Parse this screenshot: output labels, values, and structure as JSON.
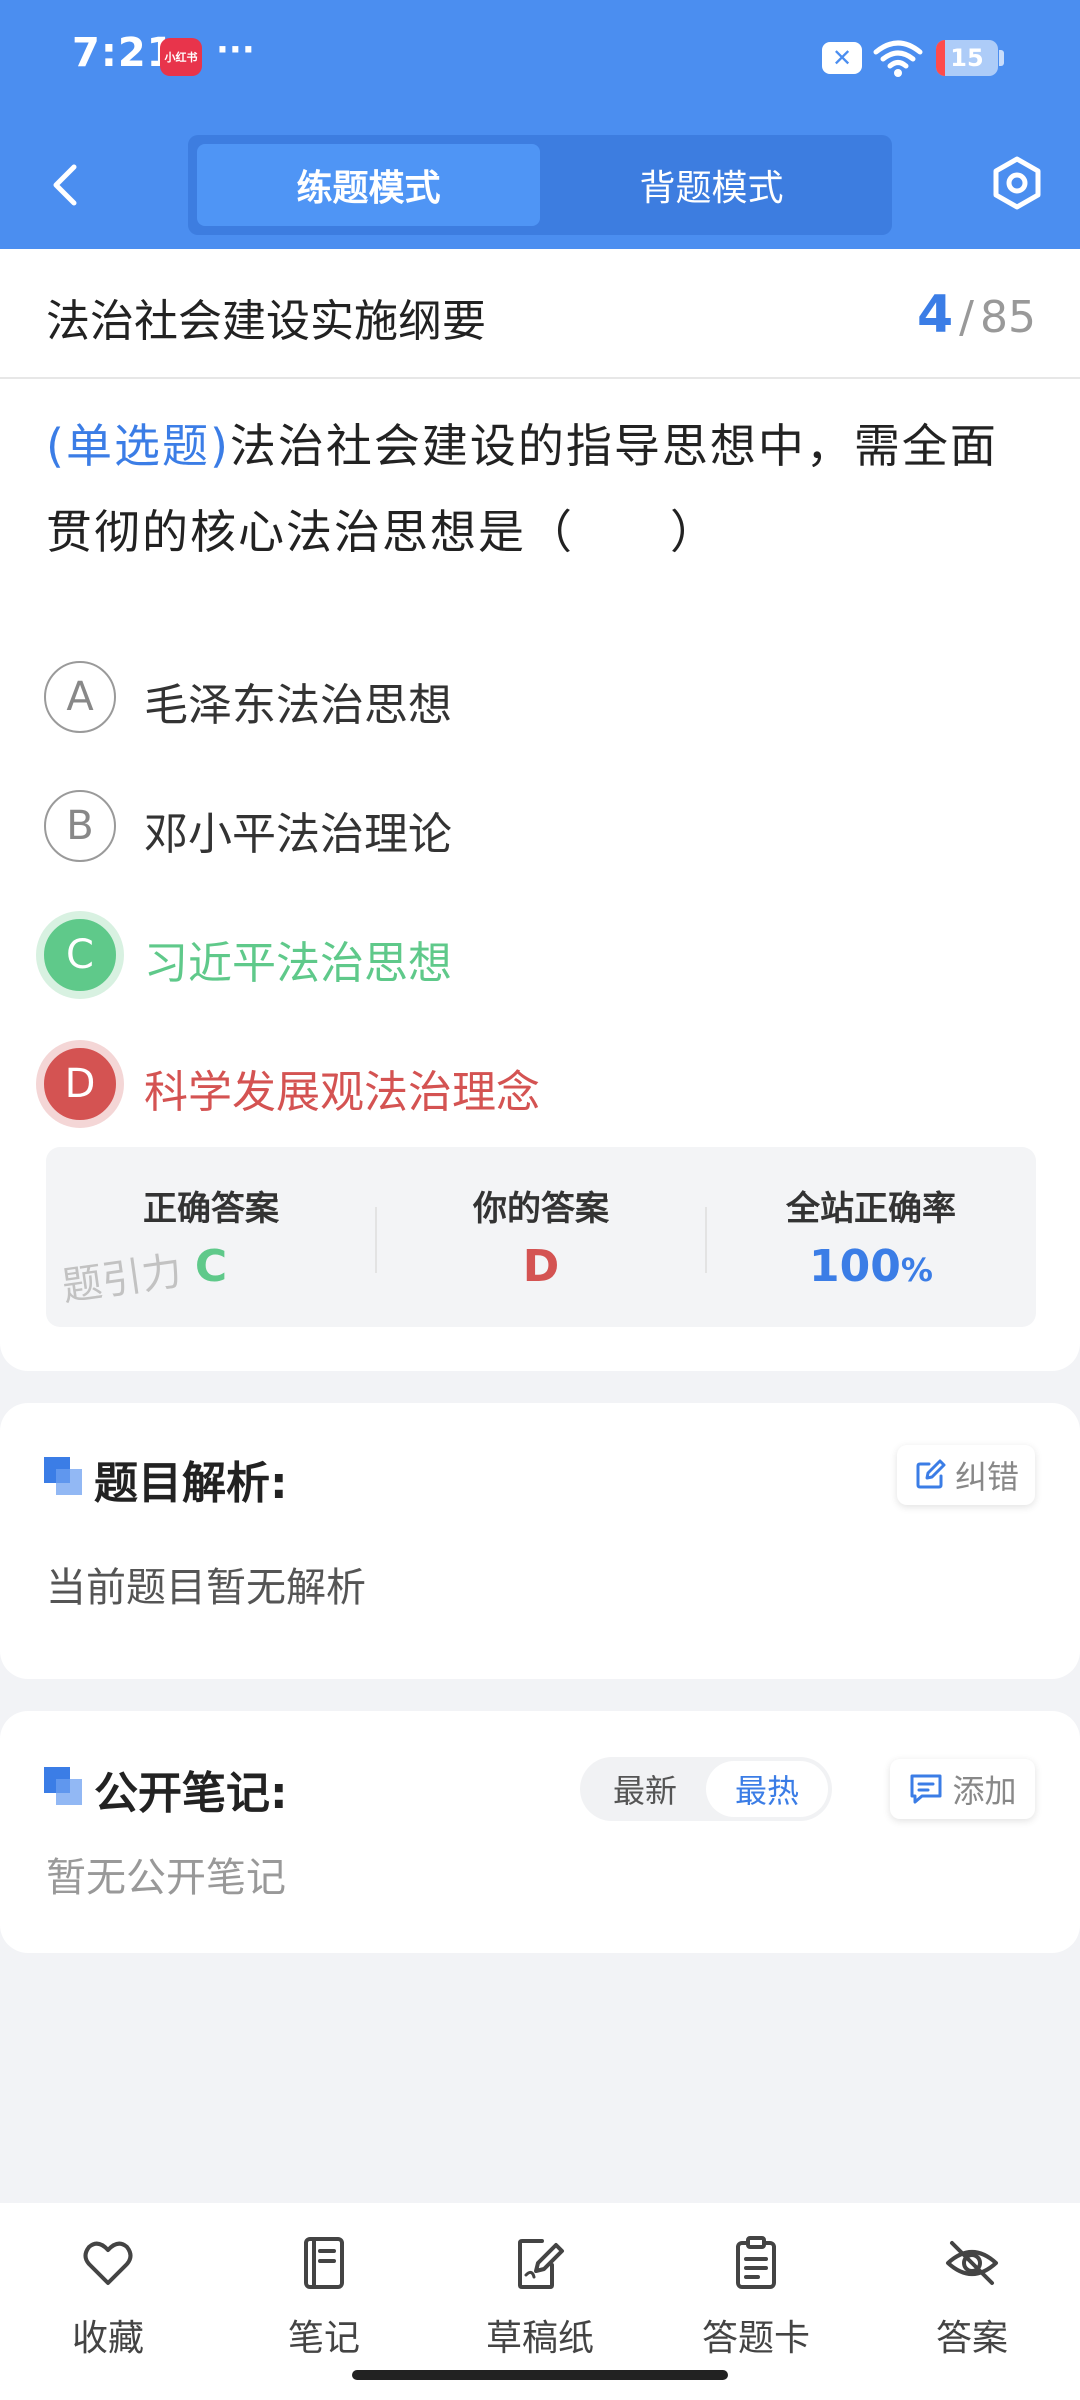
{
  "status_bar": {
    "time": "7:21",
    "app_badge": "小红书",
    "more": "···",
    "battery_level": "15",
    "battery_fraction": 0.15
  },
  "header": {
    "tabs": [
      {
        "label": "练题模式",
        "active": true
      },
      {
        "label": "背题模式",
        "active": false
      }
    ]
  },
  "question": {
    "chapter": "法治社会建设实施纲要",
    "current": "4",
    "separator": "/",
    "total": "85",
    "type_label": "(单选题)",
    "text": "法治社会建设的指导思想中，需全面贯彻的核心法治思想是（　　）",
    "options": [
      {
        "letter": "A",
        "text": "毛泽东法治思想",
        "state": "normal"
      },
      {
        "letter": "B",
        "text": "邓小平法治理论",
        "state": "normal"
      },
      {
        "letter": "C",
        "text": "习近平法治思想",
        "state": "correct"
      },
      {
        "letter": "D",
        "text": "科学发展观法治理念",
        "state": "wrong"
      }
    ]
  },
  "result": {
    "correct_label": "正确答案",
    "correct_value": "C",
    "yours_label": "你的答案",
    "yours_value": "D",
    "rate_label": "全站正确率",
    "rate_value": "100",
    "rate_unit": "%",
    "watermark": "题引力",
    "colors": {
      "correct": "#5fc98a",
      "wrong": "#d45352",
      "rate": "#3b7de6"
    }
  },
  "analysis": {
    "title": "题目解析:",
    "report_label": "纠错",
    "content": "当前题目暂无解析"
  },
  "notes": {
    "title": "公开笔记:",
    "sort_options": [
      {
        "label": "最新",
        "active": false
      },
      {
        "label": "最热",
        "active": true
      }
    ],
    "add_label": "添加",
    "empty_text": "暂无公开笔记"
  },
  "bottom_nav": [
    {
      "label": "收藏",
      "icon": "heart-icon"
    },
    {
      "label": "笔记",
      "icon": "notebook-icon"
    },
    {
      "label": "草稿纸",
      "icon": "draft-paper-icon"
    },
    {
      "label": "答题卡",
      "icon": "answer-card-icon"
    },
    {
      "label": "答案",
      "icon": "eye-off-icon"
    }
  ],
  "theme": {
    "primary": "#4b8ef0",
    "accent": "#3b7de6"
  }
}
